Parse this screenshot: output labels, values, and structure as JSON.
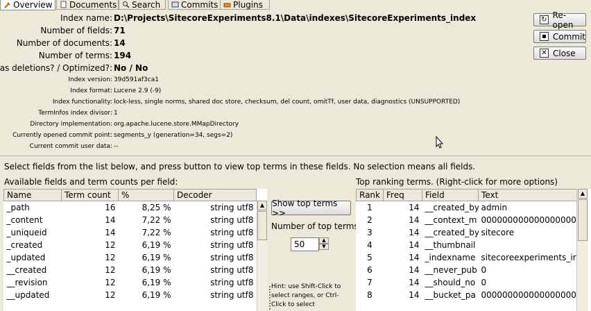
{
  "tabs": [
    {
      "label": "Overview",
      "active": true,
      "icon": "tools-icon"
    },
    {
      "label": "Documents",
      "active": false,
      "icon": "document-icon"
    },
    {
      "label": "Search",
      "active": false,
      "icon": "search-icon"
    },
    {
      "label": "Commits",
      "active": false,
      "icon": "commits-icon"
    },
    {
      "label": "Plugins",
      "active": false,
      "icon": "plugins-icon"
    }
  ],
  "info": {
    "index_name_label": "Index name:",
    "index_name": "D:\\Projects\\SitecoreExperiments8.1\\Data\\indexes\\SitecoreExperiments_index",
    "num_fields_label": "Number of fields:",
    "num_fields": "71",
    "num_docs_label": "Number of documents:",
    "num_docs": "14",
    "num_terms_label": "Number of terms:",
    "num_terms": "194",
    "deletions_label": "Has deletions? / Optimized?:",
    "deletions": "No / No",
    "index_version_label": "Index version:",
    "index_version": "39d591af3ca1",
    "index_format_label": "Index format:",
    "index_format": "Lucene 2.9 (-9)",
    "functionality_label": "Index functionality:",
    "functionality": "lock-less, single norms, shared doc store, checksum, del count, omitTf, user data, diagnostics (UNSUPPORTED)",
    "terminfos_label": "TermInfos index divisor:",
    "terminfos": "1",
    "directory_label": "Directory implementation:",
    "directory": "org.apache.lucene.store.MMapDirectory",
    "commit_point_label": "Currently opened commit point:",
    "commit_point": "segments_y (generation=34, segs=2)",
    "commit_user_label": "Current commit user data:",
    "commit_user": "--"
  },
  "actions": {
    "reopen": "Re-open",
    "commit": "Commit",
    "close": "Close"
  },
  "instructions": "Select fields from the list below, and press button to view top terms in these fields. No selection means all fields.",
  "fields_panel": {
    "title": "Available fields and term counts per field:",
    "columns": [
      "Name",
      "Term count",
      "%",
      "Decoder"
    ],
    "rows": [
      [
        "_path",
        "16",
        "8,25 %",
        "string utf8"
      ],
      [
        "_content",
        "14",
        "7,22 %",
        "string utf8"
      ],
      [
        "_uniqueid",
        "14",
        "7,22 %",
        "string utf8"
      ],
      [
        "_created",
        "12",
        "6,19 %",
        "string utf8"
      ],
      [
        "_updated",
        "12",
        "6,19 %",
        "string utf8"
      ],
      [
        "__created",
        "12",
        "6,19 %",
        "string utf8"
      ],
      [
        "__revision",
        "12",
        "6,19 %",
        "string utf8"
      ],
      [
        "__updated",
        "12",
        "6,19 %",
        "string utf8"
      ]
    ]
  },
  "middle": {
    "show_top_terms": "Show top terms >>",
    "num_top_label": "Number of top terms:",
    "num_top_value": "50",
    "hint": "Hint: use Shift-Click to select ranges, or Ctrl-Click to select"
  },
  "terms_panel": {
    "title": "Top ranking terms. (Right-click for more options)",
    "columns": [
      "Rank",
      "Freq",
      "Field",
      "Text"
    ],
    "rows": [
      [
        "1",
        "14",
        "__created_by",
        "admin"
      ],
      [
        "2",
        "14",
        "__context_m",
        "000000000000000000"
      ],
      [
        "3",
        "14",
        "__created_by",
        "sitecore"
      ],
      [
        "4",
        "14",
        "__thumbnail",
        ""
      ],
      [
        "5",
        "14",
        "_indexname",
        "sitecoreexperiments_ir"
      ],
      [
        "6",
        "14",
        "__never_pub",
        "0"
      ],
      [
        "7",
        "14",
        "__should_no",
        "0"
      ],
      [
        "8",
        "14",
        "__bucket_pa",
        "000000000000000000"
      ]
    ]
  }
}
